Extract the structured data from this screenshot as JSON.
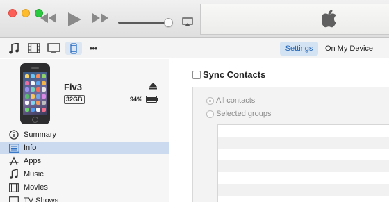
{
  "window": {
    "traffic_lights": [
      "close",
      "minimize",
      "zoom"
    ]
  },
  "transport": {
    "rewind_icon": "rewind-icon",
    "play_icon": "play-icon",
    "fast_forward_icon": "fast-forward-icon",
    "volume_level": 0.88,
    "airplay_icon": "airplay-icon",
    "logo_icon": "apple-logo-icon"
  },
  "toolbar": {
    "media_icons": [
      "music-icon",
      "movies-icon",
      "tv-icon",
      "iphone-icon",
      "more-icon"
    ],
    "selected_media": "iphone-icon",
    "segments": {
      "settings": "Settings",
      "on_my_device": "On My Device"
    },
    "selected_segment": "Settings",
    "accent_color": "#1f62b3"
  },
  "device": {
    "name": "Fiv3",
    "capacity": "32GB",
    "battery": "94%"
  },
  "sidebar": {
    "items": [
      {
        "label": "Summary",
        "icon": "info-circle-icon"
      },
      {
        "label": "Info",
        "icon": "list-icon",
        "selected": true
      },
      {
        "label": "Apps",
        "icon": "apps-icon"
      },
      {
        "label": "Music",
        "icon": "music-note-icon"
      },
      {
        "label": "Movies",
        "icon": "film-icon"
      },
      {
        "label": "TV Shows",
        "icon": "tv-icon"
      }
    ]
  },
  "main": {
    "sync_title": "Sync Contacts",
    "sync_checked": false,
    "options": [
      {
        "label": "All contacts",
        "selected": true
      },
      {
        "label": "Selected groups",
        "selected": false
      }
    ]
  }
}
